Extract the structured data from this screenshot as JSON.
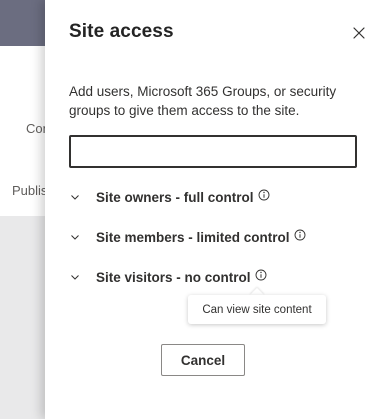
{
  "background": {
    "text_1": "Con",
    "text_2": "Publis"
  },
  "panel": {
    "title": "Site access",
    "close_icon": "close-icon",
    "description": "Add users, Microsoft 365 Groups, or security groups to give them access to the site.",
    "search": {
      "value": "",
      "placeholder": ""
    },
    "groups": [
      {
        "label": "Site owners - full control",
        "icon": "chevron-down-icon",
        "info_icon": "info-icon"
      },
      {
        "label": "Site members - limited control",
        "icon": "chevron-down-icon",
        "info_icon": "info-icon"
      },
      {
        "label": "Site visitors - no control",
        "icon": "chevron-down-icon",
        "info_icon": "info-icon"
      }
    ],
    "tooltip": "Can view site content",
    "cancel_label": "Cancel"
  },
  "colors": {
    "header": "#6b6d80",
    "text": "#323130",
    "border": "#8a8886"
  }
}
